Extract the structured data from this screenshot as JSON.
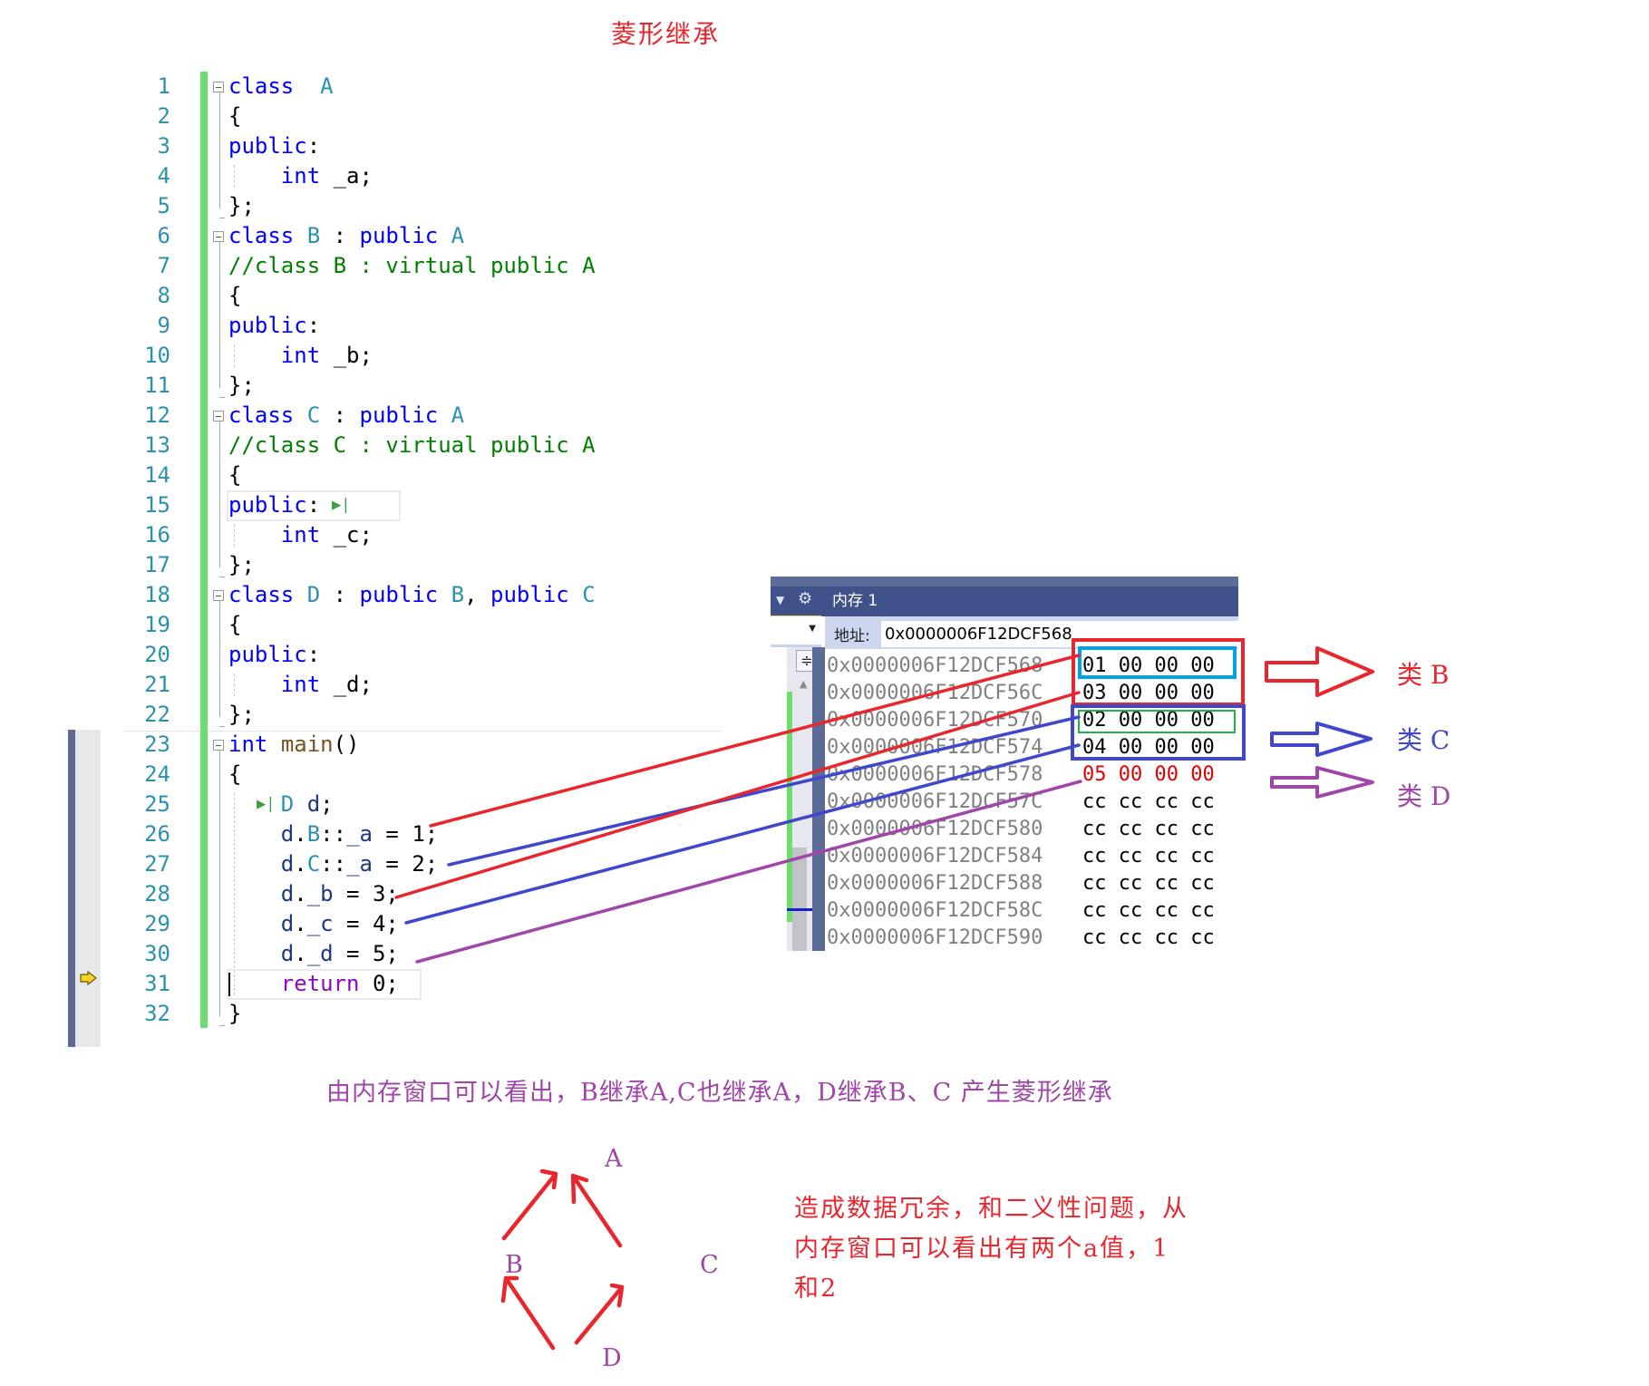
{
  "title": "菱形继承",
  "editor": {
    "lines": [
      {
        "n": "1",
        "tokens": [
          [
            "kw",
            "class"
          ],
          [
            "",
            "  "
          ],
          [
            "ty",
            "A"
          ]
        ]
      },
      {
        "n": "2",
        "tokens": [
          [
            "",
            "{"
          ]
        ]
      },
      {
        "n": "3",
        "tokens": [
          [
            "kw",
            "public"
          ],
          [
            "",
            ":"
          ]
        ]
      },
      {
        "n": "4",
        "tokens": [
          [
            "",
            "    "
          ],
          [
            "kw",
            "int"
          ],
          [
            "",
            " _a;"
          ]
        ]
      },
      {
        "n": "5",
        "tokens": [
          [
            "",
            "};"
          ]
        ]
      },
      {
        "n": "6",
        "tokens": [
          [
            "kw",
            "class"
          ],
          [
            "",
            " "
          ],
          [
            "ty",
            "B"
          ],
          [
            "",
            " : "
          ],
          [
            "kw",
            "public"
          ],
          [
            "",
            " "
          ],
          [
            "ty",
            "A"
          ]
        ]
      },
      {
        "n": "7",
        "tokens": [
          [
            "cm",
            "//class B : virtual public A"
          ]
        ]
      },
      {
        "n": "8",
        "tokens": [
          [
            "",
            "{"
          ]
        ]
      },
      {
        "n": "9",
        "tokens": [
          [
            "kw",
            "public"
          ],
          [
            "",
            ":"
          ]
        ]
      },
      {
        "n": "10",
        "tokens": [
          [
            "",
            "    "
          ],
          [
            "kw",
            "int"
          ],
          [
            "",
            " _b;"
          ]
        ]
      },
      {
        "n": "11",
        "tokens": [
          [
            "",
            "};"
          ]
        ]
      },
      {
        "n": "12",
        "tokens": [
          [
            "kw",
            "class"
          ],
          [
            "",
            " "
          ],
          [
            "ty",
            "C"
          ],
          [
            "",
            " : "
          ],
          [
            "kw",
            "public"
          ],
          [
            "",
            " "
          ],
          [
            "ty",
            "A"
          ]
        ]
      },
      {
        "n": "13",
        "tokens": [
          [
            "cm",
            "//class C : virtual public A"
          ]
        ]
      },
      {
        "n": "14",
        "tokens": [
          [
            "",
            "{"
          ]
        ]
      },
      {
        "n": "15",
        "tokens": [
          [
            "kw",
            "public"
          ],
          [
            "",
            ":"
          ]
        ]
      },
      {
        "n": "16",
        "tokens": [
          [
            "",
            "    "
          ],
          [
            "kw",
            "int"
          ],
          [
            "",
            " _c;"
          ]
        ]
      },
      {
        "n": "17",
        "tokens": [
          [
            "",
            "};"
          ]
        ]
      },
      {
        "n": "18",
        "tokens": [
          [
            "kw",
            "class"
          ],
          [
            "",
            " "
          ],
          [
            "ty",
            "D"
          ],
          [
            "",
            " : "
          ],
          [
            "kw",
            "public"
          ],
          [
            "",
            " "
          ],
          [
            "ty",
            "B"
          ],
          [
            "",
            ", "
          ],
          [
            "kw",
            "public"
          ],
          [
            "",
            " "
          ],
          [
            "ty",
            "C"
          ]
        ]
      },
      {
        "n": "19",
        "tokens": [
          [
            "",
            "{"
          ]
        ]
      },
      {
        "n": "20",
        "tokens": [
          [
            "kw",
            "public"
          ],
          [
            "",
            ":"
          ]
        ]
      },
      {
        "n": "21",
        "tokens": [
          [
            "",
            "    "
          ],
          [
            "kw",
            "int"
          ],
          [
            "",
            " _d;"
          ]
        ]
      },
      {
        "n": "22",
        "tokens": [
          [
            "",
            "};"
          ]
        ]
      },
      {
        "n": "23",
        "tokens": [
          [
            "kw",
            "int"
          ],
          [
            "",
            " "
          ],
          [
            "fn",
            "main"
          ],
          [
            "",
            "()"
          ]
        ]
      },
      {
        "n": "24",
        "tokens": [
          [
            "",
            "{"
          ]
        ]
      },
      {
        "n": "25",
        "tokens": [
          [
            "",
            "    "
          ],
          [
            "ty",
            "D"
          ],
          [
            "",
            " "
          ],
          [
            "id",
            "d"
          ],
          [
            "",
            ";"
          ]
        ]
      },
      {
        "n": "26",
        "tokens": [
          [
            "",
            "    "
          ],
          [
            "id",
            "d"
          ],
          [
            "",
            "."
          ],
          [
            "ty",
            "B"
          ],
          [
            "",
            "::"
          ],
          [
            "id",
            "_a"
          ],
          [
            "",
            " = 1;"
          ]
        ]
      },
      {
        "n": "27",
        "tokens": [
          [
            "",
            "    "
          ],
          [
            "id",
            "d"
          ],
          [
            "",
            "."
          ],
          [
            "ty",
            "C"
          ],
          [
            "",
            "::"
          ],
          [
            "id",
            "_a"
          ],
          [
            "",
            " = 2;"
          ]
        ]
      },
      {
        "n": "28",
        "tokens": [
          [
            "",
            "    "
          ],
          [
            "id",
            "d"
          ],
          [
            "",
            "."
          ],
          [
            "id",
            "_b"
          ],
          [
            "",
            " = 3;"
          ]
        ]
      },
      {
        "n": "29",
        "tokens": [
          [
            "",
            "    "
          ],
          [
            "id",
            "d"
          ],
          [
            "",
            "."
          ],
          [
            "id",
            "_c"
          ],
          [
            "",
            " = 4;"
          ]
        ]
      },
      {
        "n": "30",
        "tokens": [
          [
            "",
            "    "
          ],
          [
            "id",
            "d"
          ],
          [
            "",
            "."
          ],
          [
            "id",
            "_d"
          ],
          [
            "",
            " = 5;"
          ]
        ]
      },
      {
        "n": "31",
        "tokens": [
          [
            "",
            "    "
          ],
          [
            "rt",
            "return"
          ],
          [
            "",
            " 0;"
          ]
        ]
      },
      {
        "n": "32",
        "tokens": [
          [
            "",
            "}"
          ]
        ]
      }
    ],
    "current_line": "31",
    "run_to_cursor_glyph": "▶|"
  },
  "memory_window": {
    "title": "内存 1",
    "address_label": "地址:",
    "address_value": "0x0000006F12DCF568",
    "rows": [
      {
        "addr": "0x0000006F12DCF568",
        "bytes": "01 00 00 00",
        "changed": false
      },
      {
        "addr": "0x0000006F12DCF56C",
        "bytes": "03 00 00 00",
        "changed": false
      },
      {
        "addr": "0x0000006F12DCF570",
        "bytes": "02 00 00 00",
        "changed": false
      },
      {
        "addr": "0x0000006F12DCF574",
        "bytes": "04 00 00 00",
        "changed": false
      },
      {
        "addr": "0x0000006F12DCF578",
        "bytes": "05 00 00 00",
        "changed": true
      },
      {
        "addr": "0x0000006F12DCF57C",
        "bytes": "cc cc cc cc",
        "changed": false
      },
      {
        "addr": "0x0000006F12DCF580",
        "bytes": "cc cc cc cc",
        "changed": false
      },
      {
        "addr": "0x0000006F12DCF584",
        "bytes": "cc cc cc cc",
        "changed": false
      },
      {
        "addr": "0x0000006F12DCF588",
        "bytes": "cc cc cc cc",
        "changed": false
      },
      {
        "addr": "0x0000006F12DCF58C",
        "bytes": "cc cc cc cc",
        "changed": false
      },
      {
        "addr": "0x0000006F12DCF590",
        "bytes": "cc cc cc cc",
        "changed": false
      }
    ]
  },
  "annotations": {
    "class_labels": [
      {
        "text": "类 B",
        "color": "#e8262d"
      },
      {
        "text": "类 C",
        "color": "#3f48cc"
      },
      {
        "text": "类 D",
        "color": "#a046a8"
      }
    ],
    "colors": {
      "red": "#e8262d",
      "blue": "#3f48cc",
      "purple": "#a046a8",
      "cyan": "#00a2e8",
      "green": "#22b14c"
    },
    "explanation": "由内存窗口可以看出，B继承A,C也继承A，D继承B、C 产生菱形继承",
    "note": "造成数据冗余，和二义性问题，从内存窗口可以看出有两个a值，1和2"
  },
  "diagram": {
    "nodes": [
      "A",
      "B",
      "C",
      "D"
    ],
    "edges": [
      [
        "B",
        "A"
      ],
      [
        "C",
        "A"
      ],
      [
        "D",
        "B"
      ],
      [
        "D",
        "C"
      ]
    ]
  }
}
